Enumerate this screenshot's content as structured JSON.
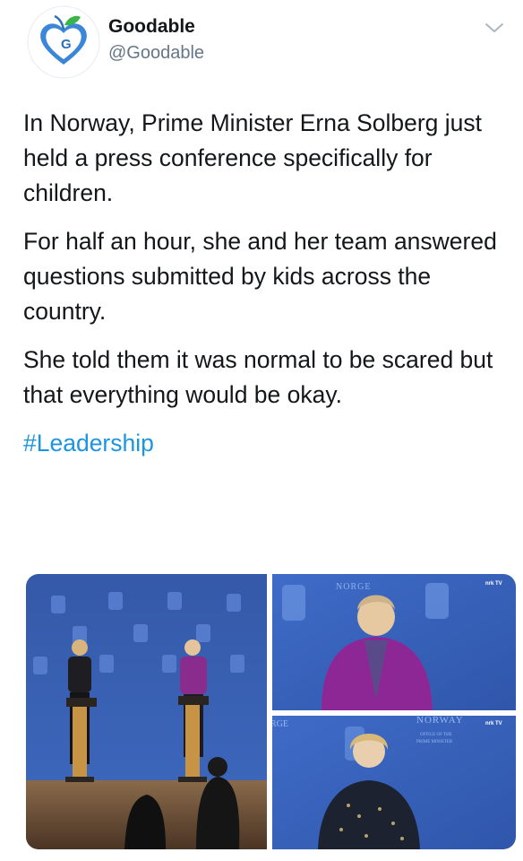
{
  "account": {
    "display_name": "Goodable",
    "handle": "@Goodable",
    "avatar_letter": "G",
    "avatar_icon": "heart-apple-logo"
  },
  "tweet": {
    "paragraphs": [
      "In Norway, Prime Minister Erna Solberg just held a press conference specifically for children.",
      "For half an hour, she and her team answered questions submitted by kids across the country.",
      "She told them it was normal to be scared but that everything would be okay."
    ],
    "hashtag": "#Leadership"
  },
  "media": {
    "photo_top_right_banner": "NORGE",
    "photo_bottom_right_banner": "NORWAY",
    "photo_bottom_right_sub1": "OFFICE OF THE",
    "photo_bottom_right_sub2": "PRIME MINISTER",
    "photo_bottom_left_edge": "RGE",
    "broadcaster": "nrk TV"
  },
  "colors": {
    "link": "#1b95e0",
    "backdrop_blue": "#3d64b8",
    "avatar_ring": "#3a86d8",
    "avatar_leaf": "#39b54a"
  }
}
